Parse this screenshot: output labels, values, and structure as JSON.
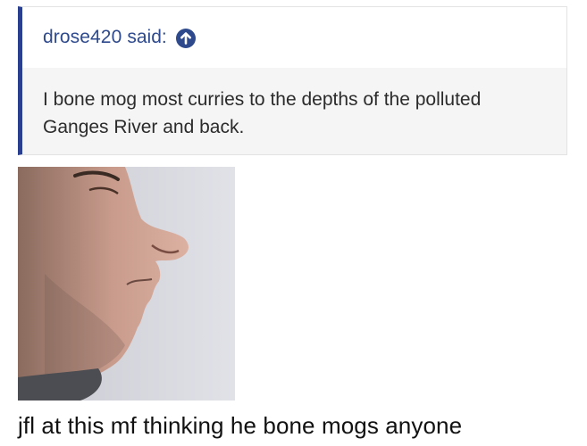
{
  "quote": {
    "author": "drose420",
    "said_label": "said:",
    "arrow_icon": "arrow-up-circle-icon",
    "text": "I bone mog most curries to the depths of the polluted Ganges River and back.",
    "accent_color": "#2a3f8f",
    "author_color": "#2e4a8d"
  },
  "image": {
    "subject": "profile-face-photo"
  },
  "post": {
    "text": "jfl at this mf thinking he bone mogs anyone"
  }
}
